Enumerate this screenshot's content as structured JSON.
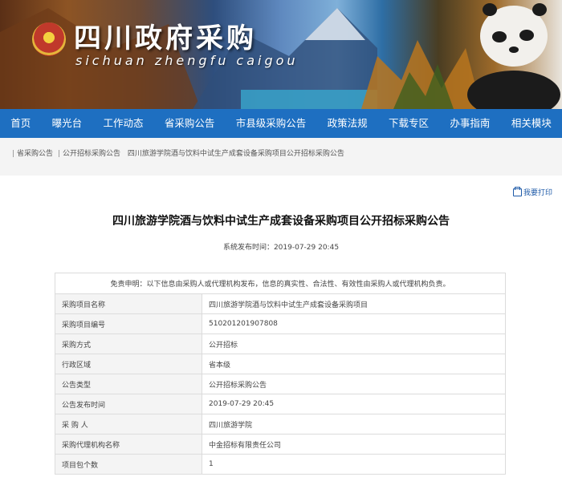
{
  "banner": {
    "title": "四川政府采购",
    "subtitle": "sichuan zhengfu caigou"
  },
  "nav": [
    "首页",
    "曝光台",
    "工作动态",
    "省采购公告",
    "市县级采购公告",
    "政策法规",
    "下载专区",
    "办事指南",
    "相关模块"
  ],
  "breadcrumb": [
    "省采购公告",
    "公开招标采购公告",
    "四川旅游学院酒与饮料中试生产成套设备采购项目公开招标采购公告"
  ],
  "print_label": "我要打印",
  "article": {
    "title": "四川旅游学院酒与饮料中试生产成套设备采购项目公开招标采购公告",
    "publish_time": "系统发布时间：2019-07-29 20:45",
    "disclaimer": "免责申明：以下信息由采购人或代理机构发布，信息的真实性、合法性、有效性由采购人或代理机构负责。",
    "rows": [
      {
        "label": "采购项目名称",
        "value": "四川旅游学院酒与饮料中试生产成套设备采购项目"
      },
      {
        "label": "采购项目编号",
        "value": "510201201907808"
      },
      {
        "label": "采购方式",
        "value": "公开招标"
      },
      {
        "label": "行政区域",
        "value": "省本级"
      },
      {
        "label": "公告类型",
        "value": "公开招标采购公告"
      },
      {
        "label": "公告发布时间",
        "value": "2019-07-29 20:45"
      },
      {
        "label": "采 购 人",
        "value": "四川旅游学院"
      },
      {
        "label": "采购代理机构名称",
        "value": "中金招标有限责任公司"
      },
      {
        "label": "项目包个数",
        "value": "1"
      }
    ]
  }
}
